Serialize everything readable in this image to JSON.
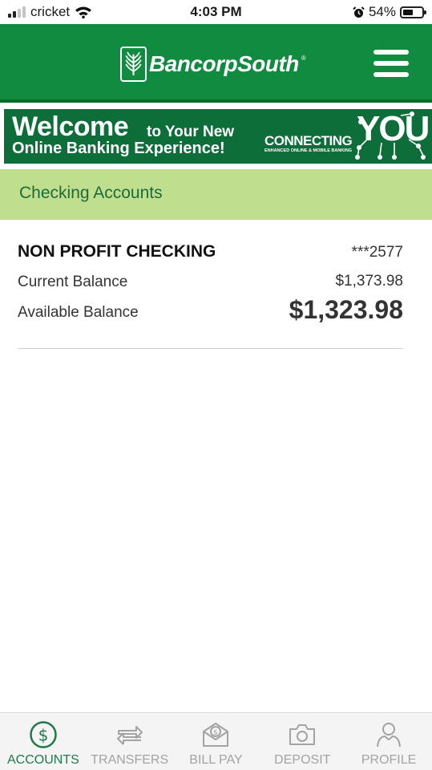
{
  "status_bar": {
    "carrier": "cricket",
    "time": "4:03 PM",
    "battery": "54%",
    "battery_level": 0.54
  },
  "header": {
    "logo_text": "BancorpSouth",
    "logo_reg": "®"
  },
  "banner": {
    "welcome_big": "Welcome",
    "welcome_small": "to Your New",
    "welcome_line2": "Online Banking Experience!",
    "connecting": "CONNECTING",
    "connecting_sub": "ENHANCED ONLINE & MOBILE BANKING",
    "you": "YOU"
  },
  "section": {
    "title": "Checking Accounts"
  },
  "account": {
    "name": "NON PROFIT CHECKING",
    "number": "***2577",
    "current_label": "Current Balance",
    "current_value": "$1,373.98",
    "available_label": "Available Balance",
    "available_value": "$1,323.98"
  },
  "nav": {
    "items": [
      {
        "label": "ACCOUNTS",
        "icon": "dollar-circle-icon",
        "active": true
      },
      {
        "label": "TRANSFERS",
        "icon": "transfer-arrows-icon",
        "active": false
      },
      {
        "label": "BILL PAY",
        "icon": "bill-pay-envelope-icon",
        "active": false
      },
      {
        "label": "DEPOSIT",
        "icon": "camera-icon",
        "active": false
      },
      {
        "label": "PROFILE",
        "icon": "person-icon",
        "active": false
      }
    ]
  },
  "colors": {
    "brand_green": "#118b3f",
    "banner_green": "#0e6e3a",
    "section_bg": "#bfdf8e",
    "section_text": "#1e6b3a",
    "nav_active": "#1e7a4a",
    "nav_inactive": "#a3a3a3"
  }
}
